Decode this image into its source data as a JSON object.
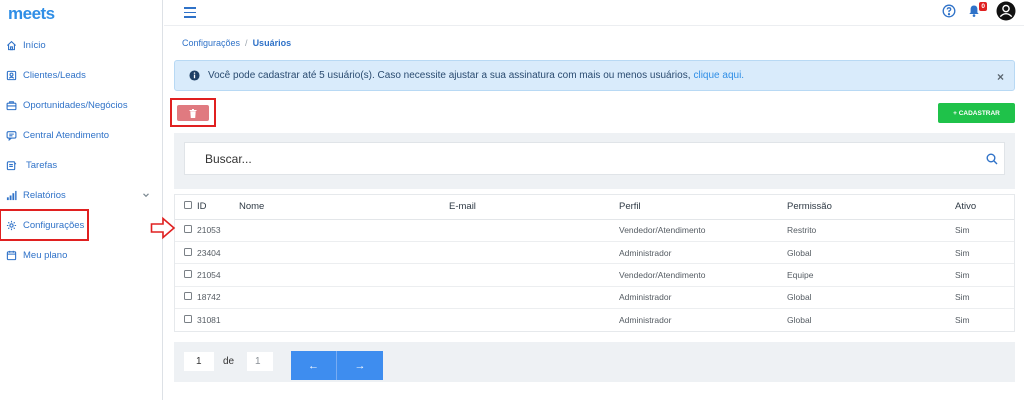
{
  "app": {
    "logo": "meets"
  },
  "sidebar": {
    "items": [
      {
        "label": "Início",
        "icon": "home-icon"
      },
      {
        "label": "Clientes/Leads",
        "icon": "contact-card-icon"
      },
      {
        "label": "Oportunidades/Negócios",
        "icon": "briefcase-icon"
      },
      {
        "label": "Central Atendimento",
        "icon": "chat-icon"
      },
      {
        "label": "Tarefas",
        "icon": "tasks-icon"
      },
      {
        "label": "Relatórios",
        "icon": "bar-chart-icon"
      },
      {
        "label": "Configurações",
        "icon": "gear-icon"
      },
      {
        "label": "Meu plano",
        "icon": "calendar-icon"
      }
    ]
  },
  "header": {
    "notification_count": "0"
  },
  "breadcrumb": {
    "parent": "Configurações",
    "separator": "/",
    "current": "Usuários"
  },
  "alert": {
    "text": "Você pode cadastrar até 5 usuário(s). Caso necessite ajustar a sua assinatura com mais ou menos usuários,",
    "link": "clique aqui.",
    "close": "×"
  },
  "toolbar": {
    "add_label": "+ CADASTRAR"
  },
  "search": {
    "placeholder": "Buscar..."
  },
  "table": {
    "headers": {
      "id": "ID",
      "nome": "Nome",
      "email": "E-mail",
      "perfil": "Perfil",
      "permissao": "Permissão",
      "ativo": "Ativo"
    },
    "rows": [
      {
        "id": "21053",
        "nome": "",
        "email": "",
        "perfil": "Vendedor/Atendimento",
        "permissao": "Restrito",
        "ativo": "Sim"
      },
      {
        "id": "23404",
        "nome": "",
        "email": "",
        "perfil": "Administrador",
        "permissao": "Global",
        "ativo": "Sim"
      },
      {
        "id": "21054",
        "nome": "",
        "email": "",
        "perfil": "Vendedor/Atendimento",
        "permissao": "Equipe",
        "ativo": "Sim"
      },
      {
        "id": "18742",
        "nome": "",
        "email": "",
        "perfil": "Administrador",
        "permissao": "Global",
        "ativo": "Sim"
      },
      {
        "id": "31081",
        "nome": "",
        "email": "",
        "perfil": "Administrador",
        "permissao": "Global",
        "ativo": "Sim"
      }
    ]
  },
  "pagination": {
    "current": "1",
    "of_label": "de",
    "total": "1",
    "prev": "←",
    "next": "→"
  },
  "colors": {
    "accent": "#2f72c8",
    "success": "#1fc24a",
    "danger": "#e07a80",
    "highlight": "#e02020"
  }
}
